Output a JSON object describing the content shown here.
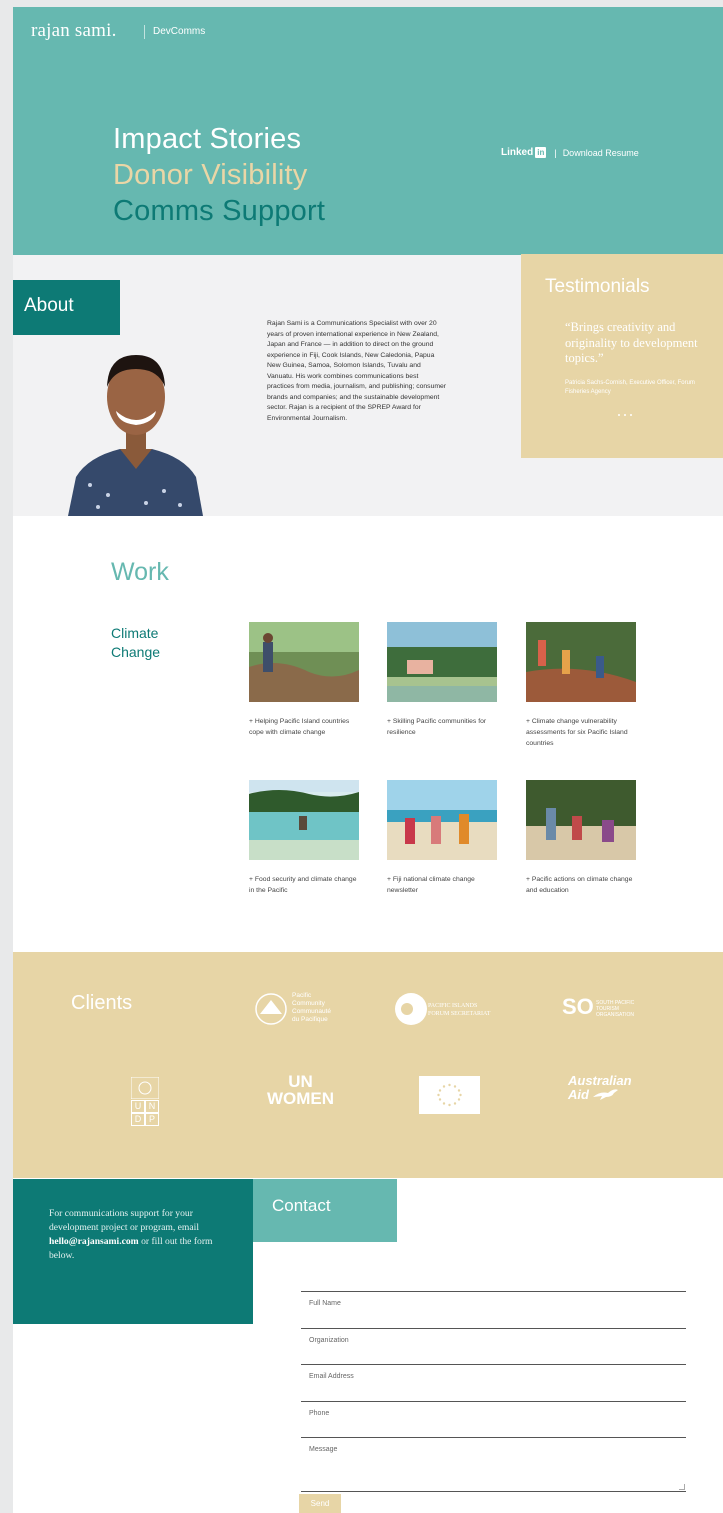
{
  "header": {
    "logo": "rajan sami.",
    "logo_sub": "DevComms"
  },
  "hero": {
    "taglines": [
      "Impact Stories",
      "Donor Visibility",
      "Comms Support"
    ],
    "linkedin_label": "Linked",
    "linkedin_badge": "in",
    "separator": "|",
    "download_label": "Download Resume"
  },
  "about": {
    "title": "About",
    "text": "Rajan Sami is a Communications Specialist with over 20 years of proven international experience in New Zealand, Japan and France — in addition to direct on the ground experience in Fiji, Cook Islands, New Caledonia, Papua New Guinea, Samoa, Solomon Islands, Tuvalu and Vanuatu. His work combines communications best practices from media, journalism, and publishing; consumer brands and companies; and the sustainable development sector. Rajan is a recipient of the SPREP Award for Environmental Journalism."
  },
  "testimonials": {
    "title": "Testimonials",
    "quote": "“Brings creativity and originality to development topics.”",
    "author": "Patricia Sachs-Cornish, Executive Officer, Forum Fisheries Agency"
  },
  "work": {
    "title": "Work",
    "category_line1": "Climate",
    "category_line2": "Change",
    "items": [
      {
        "caption": "+ Helping Pacific Island countries cope with climate change"
      },
      {
        "caption": "+ Skilling Pacific communities for resilience"
      },
      {
        "caption": "+ Climate change vulnerability assessments for six Pacific Island countries"
      },
      {
        "caption": "+ Food security and climate change in the Pacific"
      },
      {
        "caption": "+ Fiji national climate change newsletter"
      },
      {
        "caption": "+ Pacific actions on climate change and education"
      }
    ]
  },
  "clients": {
    "title": "Clients",
    "logos": {
      "spc_line1": "Pacific",
      "spc_line2": "Community",
      "spc_line3": "Communauté",
      "spc_line4": "du Pacifique",
      "pifs_line1": "PACIFIC ISLANDS",
      "pifs_line2": "FORUM SECRETARIAT",
      "spto_mark": "SO",
      "spto_line1": "SOUTH PACIFIC",
      "spto_line2": "TOURISM",
      "spto_line3": "ORGANISATION",
      "undp_u": "U",
      "undp_n": "N",
      "undp_d": "D",
      "undp_p": "P",
      "unwomen_line1": "UN",
      "unwomen_line2": "WOMEN",
      "ausaid_line1": "Australian",
      "ausaid_line2": "Aid"
    }
  },
  "contact": {
    "title": "Contact",
    "text_before": "For communications support for your development project or program, email",
    "email": "hello@rajansami.com",
    "text_after": "or fill out the form below.",
    "fields": [
      "Full Name",
      "Organization",
      "Email Address",
      "Phone",
      "Message"
    ],
    "send_label": "Send"
  },
  "colors": {
    "teal": "#66b8b0",
    "dark_teal": "#0d7a75",
    "sand": "#e7d5a6"
  }
}
